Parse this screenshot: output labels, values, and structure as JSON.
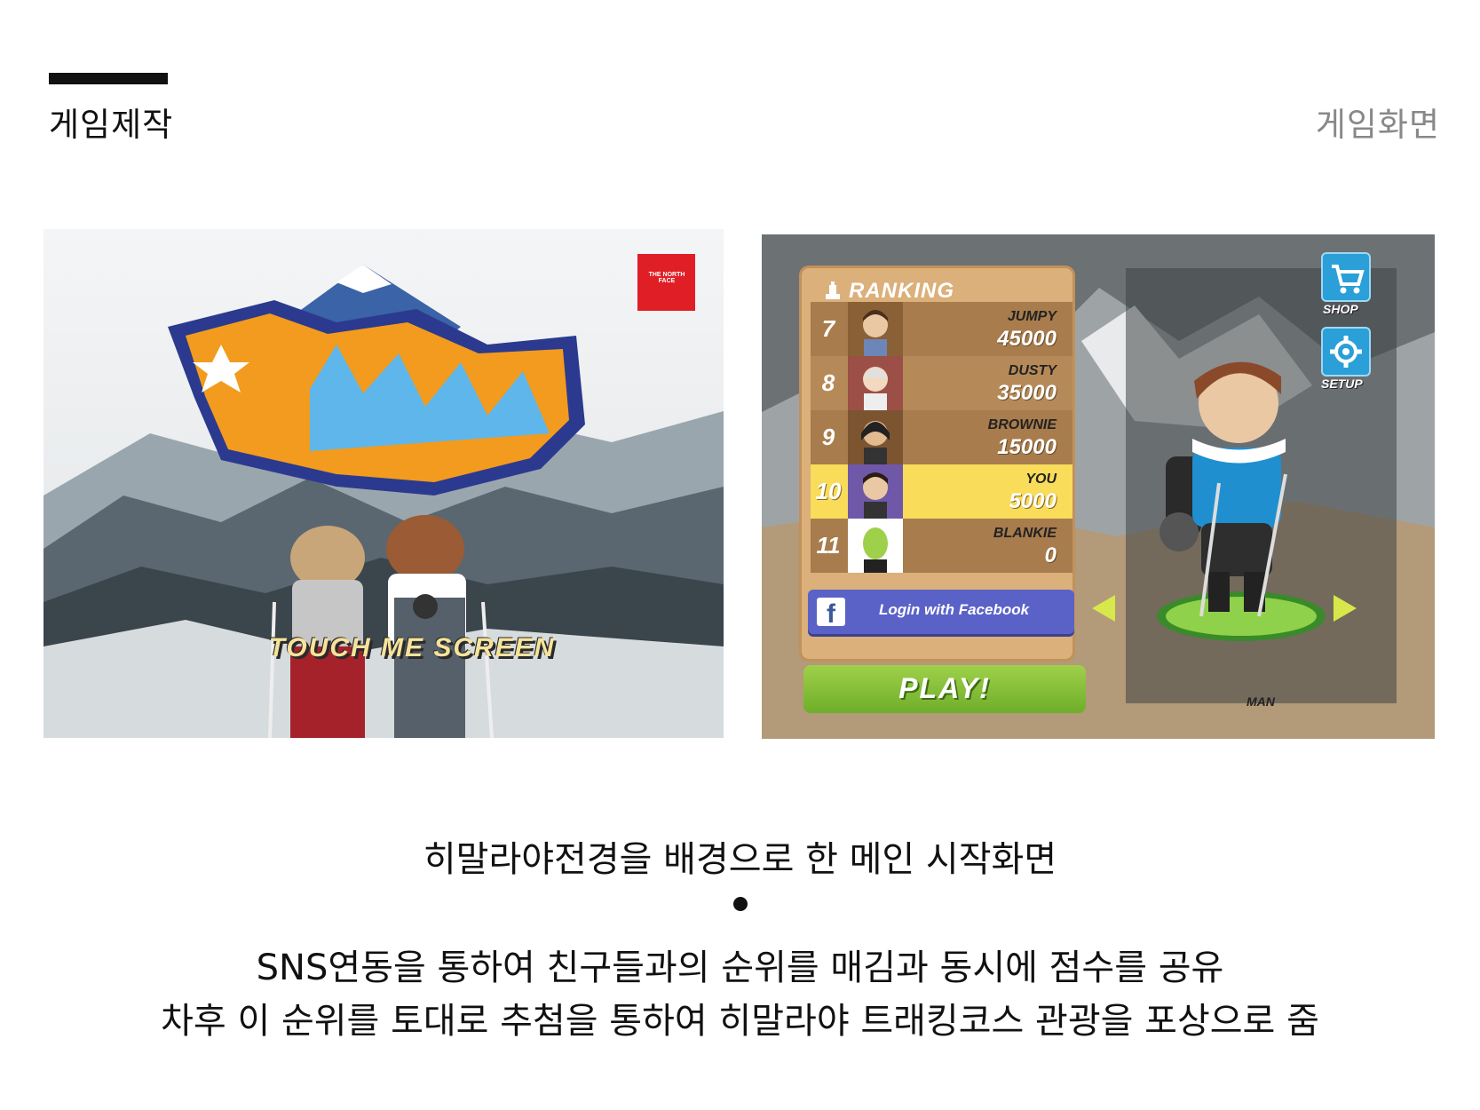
{
  "header": {
    "title": "게임제작",
    "subtitle": "게임화면"
  },
  "left_screenshot": {
    "brand_logo": "THE NORTH FACE",
    "touch_prompt": "TOUCH ME SCREEN",
    "game_logo_icon": "game-title-logo-icon"
  },
  "right_screenshot": {
    "ranking_title": "RANKING",
    "ranking": [
      {
        "rank": "7",
        "name": "JUMPY",
        "score": "45000"
      },
      {
        "rank": "8",
        "name": "DUSTY",
        "score": "35000"
      },
      {
        "rank": "9",
        "name": "BROWNIE",
        "score": "15000"
      },
      {
        "rank": "10",
        "name": "YOU",
        "score": "5000"
      },
      {
        "rank": "11",
        "name": "BLANKIE",
        "score": "0"
      }
    ],
    "facebook_button": "Login with Facebook",
    "play_button": "PLAY!",
    "shop_label": "SHOP",
    "setup_label": "SETUP",
    "character_label": "MAN",
    "highlight_color": "#f8dc5a"
  },
  "captions": {
    "line1": "히말라야전경을 배경으로 한 메인 시작화면",
    "line2": "SNS연동을 통하여 친구들과의 순위를 매김과 동시에 점수를 공유",
    "line3": "차후 이 순위를 토대로 추첨을 통하여 히말라야 트래킹코스 관광을 포상으로 줌"
  }
}
